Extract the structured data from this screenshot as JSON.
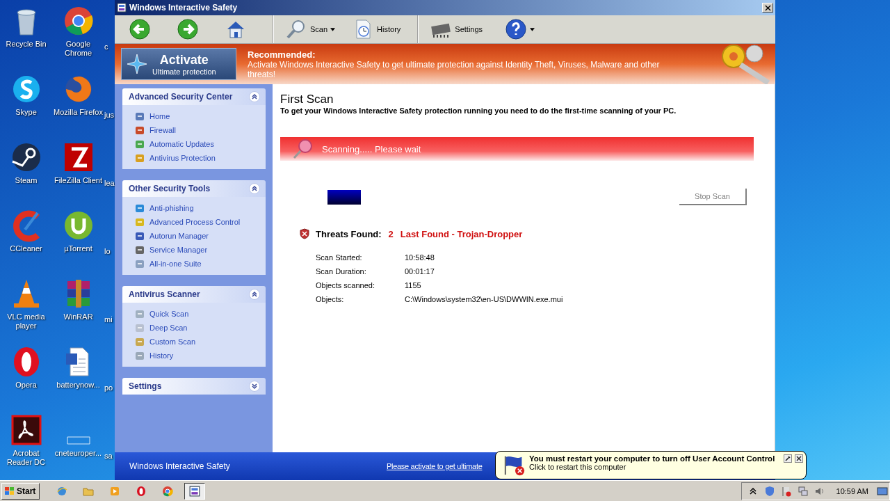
{
  "desktop_rows": [
    {
      "icons": [
        {
          "label": "Recycle Bin"
        },
        {
          "label": "Google Chrome"
        }
      ],
      "partial_label": "c"
    },
    {
      "icons": [
        {
          "label": "Skype"
        },
        {
          "label": "Mozilla Firefox"
        }
      ],
      "partial_label": "jus"
    },
    {
      "icons": [
        {
          "label": "Steam"
        },
        {
          "label": "FileZilla Client"
        }
      ],
      "partial_label": "lea"
    },
    {
      "icons": [
        {
          "label": "CCleaner"
        },
        {
          "label": "µTorrent"
        }
      ],
      "partial_label": "lo"
    },
    {
      "icons": [
        {
          "label": "VLC media player"
        },
        {
          "label": "WinRAR"
        }
      ],
      "partial_label": "mi"
    },
    {
      "icons": [
        {
          "label": "Opera"
        },
        {
          "label": "batterynow..."
        }
      ],
      "partial_label": "po"
    },
    {
      "icons": [
        {
          "label": "Acrobat Reader DC"
        },
        {
          "label": "cneteuroper..."
        }
      ],
      "partial_label": "sa"
    }
  ],
  "window": {
    "title": "Windows Interactive Safety",
    "toolbar": [
      {
        "kind": "back"
      },
      {
        "kind": "forward"
      },
      {
        "kind": "home"
      },
      {
        "kind": "scan",
        "label": "Scan",
        "dropdown": true
      },
      {
        "kind": "history",
        "label": "History",
        "dropdown": false
      },
      {
        "kind": "settings",
        "label": "Settings",
        "dropdown": false
      },
      {
        "kind": "help",
        "dropdown": true
      }
    ],
    "banner": {
      "button_title": "Activate",
      "button_subtitle": "Ultimate protection",
      "heading": "Recommended:",
      "text": "Activate Windows Interactive Safety to get ultimate protection against Identity Theft, Viruses, Malware and other threats!"
    },
    "sidebar": [
      {
        "title": "Advanced Security Center",
        "expanded": true,
        "items": [
          {
            "label": "Home"
          },
          {
            "label": "Firewall"
          },
          {
            "label": "Automatic Updates"
          },
          {
            "label": "Antivirus Protection"
          }
        ]
      },
      {
        "title": "Other Security Tools",
        "expanded": true,
        "items": [
          {
            "label": "Anti-phishing"
          },
          {
            "label": "Advanced Process Control"
          },
          {
            "label": "Autorun Manager"
          },
          {
            "label": "Service Manager"
          },
          {
            "label": "All-in-one Suite"
          }
        ]
      },
      {
        "title": "Antivirus Scanner",
        "expanded": true,
        "items": [
          {
            "label": "Quick Scan"
          },
          {
            "label": "Deep Scan"
          },
          {
            "label": "Custom Scan"
          },
          {
            "label": "History"
          }
        ]
      },
      {
        "title": "Settings",
        "expanded": false
      }
    ],
    "main": {
      "title": "First Scan",
      "subtitle": "To get your Windows Interactive Safety protection running you need to do the first-time scanning of your PC.",
      "scan_banner": "Scanning..... Please wait",
      "progress": {
        "level": 0.1
      },
      "stop_button": "Stop Scan",
      "threats_label": "Threats Found:",
      "threats_count": "2",
      "last_found": "Last Found - Trojan-Dropper",
      "details": [
        {
          "label": "Scan Started:",
          "value": "10:58:48"
        },
        {
          "label": "Scan Duration:",
          "value": "00:01:17"
        },
        {
          "label": "Objects scanned:",
          "value": "1155"
        },
        {
          "label": "Objects:",
          "value": "C:\\Windows\\system32\\en-US\\DWWIN.exe.mui"
        }
      ]
    },
    "footer": {
      "name": "Windows Interactive Safety",
      "link": "Please activate to get ultimate"
    }
  },
  "notification": {
    "title": "You must restart your computer to turn off User Account Control",
    "text": "Click to restart this computer"
  },
  "taskbar": {
    "start": "Start",
    "clock": "10:59 AM"
  }
}
